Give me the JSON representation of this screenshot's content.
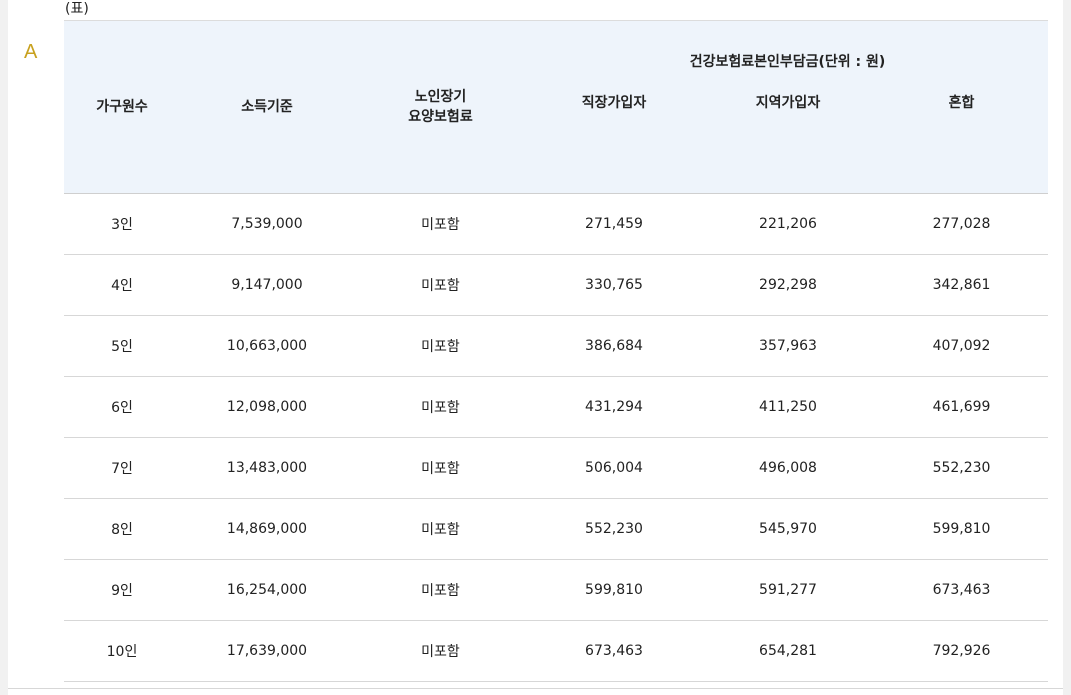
{
  "caption": "(표)",
  "option_letter": "A",
  "table": {
    "headers": {
      "household": "가구원수",
      "income": "소득기준",
      "ltc_line1": "노인장기",
      "ltc_line2": "요양보험료",
      "group": "건강보험료본인부담금(단위 : 원)",
      "employee": "직장가입자",
      "regional": "지역가입자",
      "mixed": "혼합"
    },
    "rows": [
      [
        "3인",
        "7,539,000",
        "미포함",
        "271,459",
        "221,206",
        "277,028"
      ],
      [
        "4인",
        "9,147,000",
        "미포함",
        "330,765",
        "292,298",
        "342,861"
      ],
      [
        "5인",
        "10,663,000",
        "미포함",
        "386,684",
        "357,963",
        "407,092"
      ],
      [
        "6인",
        "12,098,000",
        "미포함",
        "431,294",
        "411,250",
        "461,699"
      ],
      [
        "7인",
        "13,483,000",
        "미포함",
        "506,004",
        "496,008",
        "552,230"
      ],
      [
        "8인",
        "14,869,000",
        "미포함",
        "552,230",
        "545,970",
        "599,810"
      ],
      [
        "9인",
        "16,254,000",
        "미포함",
        "599,810",
        "591,277",
        "673,463"
      ],
      [
        "10인",
        "17,639,000",
        "미포함",
        "673,463",
        "654,281",
        "792,926"
      ]
    ]
  },
  "colors": {
    "header_bg": "#eef4fb",
    "option_letter": "#c8a11f",
    "row_border": "#d7d7d7"
  }
}
